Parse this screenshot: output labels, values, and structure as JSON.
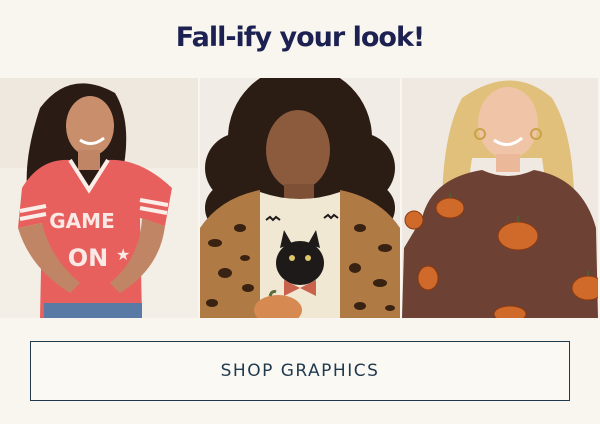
{
  "headline": "Fall-ify your look!",
  "photos": [
    {
      "name": "model-red-game-on-tee",
      "shirt_text_top": "GAME",
      "shirt_text_bottom": "ON",
      "alt_color": "#e8605e"
    },
    {
      "name": "model-black-cat-pumpkin-tee",
      "alt_color": "#f1e8d4"
    },
    {
      "name": "model-brown-sequin-pumpkin-top",
      "alt_color": "#6d4133"
    }
  ],
  "cta": {
    "label": "SHOP GRAPHICS"
  },
  "colors": {
    "navy": "#1c2151",
    "button_border": "#1f3a4d",
    "background": "#f9f6ef"
  }
}
